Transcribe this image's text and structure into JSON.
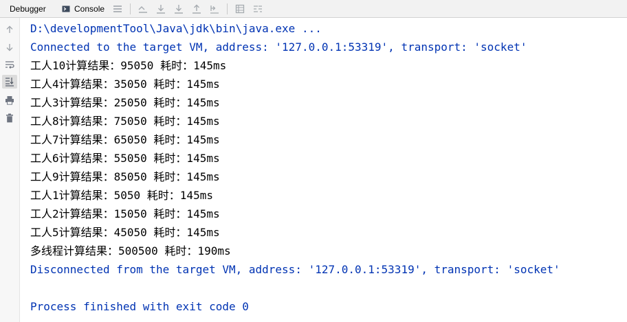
{
  "tabs": {
    "debugger_label": "Debugger",
    "console_label": "Console"
  },
  "toolbar_icons": [
    "menu-icon",
    "restore-layout-icon",
    "step-over-icon",
    "step-into-icon",
    "step-out-icon",
    "run-to-cursor-icon",
    "evaluate-icon",
    "frames-icon",
    "threads-icon"
  ],
  "gutter_icons": [
    "up-arrow-icon",
    "down-arrow-icon",
    "soft-wrap-icon",
    "scroll-to-end-icon",
    "print-icon",
    "trash-icon"
  ],
  "colors": {
    "system_text": "#0033b3",
    "output_text": "#000000",
    "tabbar_bg": "#f2f2f2",
    "gutter_bg": "#f7f7f7"
  },
  "console": {
    "command": "D:\\developmentTool\\Java\\jdk\\bin\\java.exe ...",
    "connected": "Connected to the target VM, address: '127.0.0.1:53319', transport: 'socket'",
    "output_lines": [
      "工人10计算结果：95050 耗时：145ms",
      "工人4计算结果：35050 耗时：145ms",
      "工人3计算结果：25050 耗时：145ms",
      "工人8计算结果：75050 耗时：145ms",
      "工人7计算结果：65050 耗时：145ms",
      "工人6计算结果：55050 耗时：145ms",
      "工人9计算结果：85050 耗时：145ms",
      "工人1计算结果：5050 耗时：145ms",
      "工人2计算结果：15050 耗时：145ms",
      "工人5计算结果：45050 耗时：145ms",
      "多线程计算结果：500500 耗时：190ms"
    ],
    "disconnected": "Disconnected from the target VM, address: '127.0.0.1:53319', transport: 'socket'",
    "process_finished": "Process finished with exit code 0"
  }
}
